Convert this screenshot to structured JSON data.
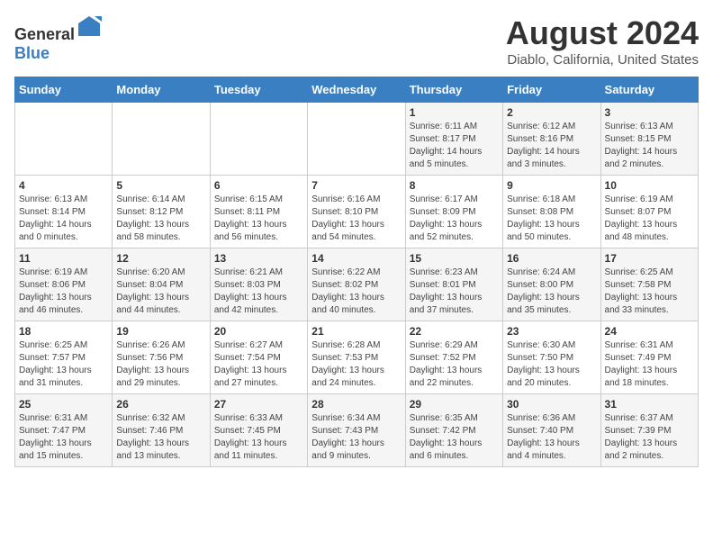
{
  "header": {
    "logo_general": "General",
    "logo_blue": "Blue",
    "title": "August 2024",
    "subtitle": "Diablo, California, United States"
  },
  "weekdays": [
    "Sunday",
    "Monday",
    "Tuesday",
    "Wednesday",
    "Thursday",
    "Friday",
    "Saturday"
  ],
  "weeks": [
    [
      {
        "day": "",
        "sunrise": "",
        "sunset": "",
        "daylight": ""
      },
      {
        "day": "",
        "sunrise": "",
        "sunset": "",
        "daylight": ""
      },
      {
        "day": "",
        "sunrise": "",
        "sunset": "",
        "daylight": ""
      },
      {
        "day": "",
        "sunrise": "",
        "sunset": "",
        "daylight": ""
      },
      {
        "day": "1",
        "sunrise": "Sunrise: 6:11 AM",
        "sunset": "Sunset: 8:17 PM",
        "daylight": "Daylight: 14 hours and 5 minutes."
      },
      {
        "day": "2",
        "sunrise": "Sunrise: 6:12 AM",
        "sunset": "Sunset: 8:16 PM",
        "daylight": "Daylight: 14 hours and 3 minutes."
      },
      {
        "day": "3",
        "sunrise": "Sunrise: 6:13 AM",
        "sunset": "Sunset: 8:15 PM",
        "daylight": "Daylight: 14 hours and 2 minutes."
      }
    ],
    [
      {
        "day": "4",
        "sunrise": "Sunrise: 6:13 AM",
        "sunset": "Sunset: 8:14 PM",
        "daylight": "Daylight: 14 hours and 0 minutes."
      },
      {
        "day": "5",
        "sunrise": "Sunrise: 6:14 AM",
        "sunset": "Sunset: 8:12 PM",
        "daylight": "Daylight: 13 hours and 58 minutes."
      },
      {
        "day": "6",
        "sunrise": "Sunrise: 6:15 AM",
        "sunset": "Sunset: 8:11 PM",
        "daylight": "Daylight: 13 hours and 56 minutes."
      },
      {
        "day": "7",
        "sunrise": "Sunrise: 6:16 AM",
        "sunset": "Sunset: 8:10 PM",
        "daylight": "Daylight: 13 hours and 54 minutes."
      },
      {
        "day": "8",
        "sunrise": "Sunrise: 6:17 AM",
        "sunset": "Sunset: 8:09 PM",
        "daylight": "Daylight: 13 hours and 52 minutes."
      },
      {
        "day": "9",
        "sunrise": "Sunrise: 6:18 AM",
        "sunset": "Sunset: 8:08 PM",
        "daylight": "Daylight: 13 hours and 50 minutes."
      },
      {
        "day": "10",
        "sunrise": "Sunrise: 6:19 AM",
        "sunset": "Sunset: 8:07 PM",
        "daylight": "Daylight: 13 hours and 48 minutes."
      }
    ],
    [
      {
        "day": "11",
        "sunrise": "Sunrise: 6:19 AM",
        "sunset": "Sunset: 8:06 PM",
        "daylight": "Daylight: 13 hours and 46 minutes."
      },
      {
        "day": "12",
        "sunrise": "Sunrise: 6:20 AM",
        "sunset": "Sunset: 8:04 PM",
        "daylight": "Daylight: 13 hours and 44 minutes."
      },
      {
        "day": "13",
        "sunrise": "Sunrise: 6:21 AM",
        "sunset": "Sunset: 8:03 PM",
        "daylight": "Daylight: 13 hours and 42 minutes."
      },
      {
        "day": "14",
        "sunrise": "Sunrise: 6:22 AM",
        "sunset": "Sunset: 8:02 PM",
        "daylight": "Daylight: 13 hours and 40 minutes."
      },
      {
        "day": "15",
        "sunrise": "Sunrise: 6:23 AM",
        "sunset": "Sunset: 8:01 PM",
        "daylight": "Daylight: 13 hours and 37 minutes."
      },
      {
        "day": "16",
        "sunrise": "Sunrise: 6:24 AM",
        "sunset": "Sunset: 8:00 PM",
        "daylight": "Daylight: 13 hours and 35 minutes."
      },
      {
        "day": "17",
        "sunrise": "Sunrise: 6:25 AM",
        "sunset": "Sunset: 7:58 PM",
        "daylight": "Daylight: 13 hours and 33 minutes."
      }
    ],
    [
      {
        "day": "18",
        "sunrise": "Sunrise: 6:25 AM",
        "sunset": "Sunset: 7:57 PM",
        "daylight": "Daylight: 13 hours and 31 minutes."
      },
      {
        "day": "19",
        "sunrise": "Sunrise: 6:26 AM",
        "sunset": "Sunset: 7:56 PM",
        "daylight": "Daylight: 13 hours and 29 minutes."
      },
      {
        "day": "20",
        "sunrise": "Sunrise: 6:27 AM",
        "sunset": "Sunset: 7:54 PM",
        "daylight": "Daylight: 13 hours and 27 minutes."
      },
      {
        "day": "21",
        "sunrise": "Sunrise: 6:28 AM",
        "sunset": "Sunset: 7:53 PM",
        "daylight": "Daylight: 13 hours and 24 minutes."
      },
      {
        "day": "22",
        "sunrise": "Sunrise: 6:29 AM",
        "sunset": "Sunset: 7:52 PM",
        "daylight": "Daylight: 13 hours and 22 minutes."
      },
      {
        "day": "23",
        "sunrise": "Sunrise: 6:30 AM",
        "sunset": "Sunset: 7:50 PM",
        "daylight": "Daylight: 13 hours and 20 minutes."
      },
      {
        "day": "24",
        "sunrise": "Sunrise: 6:31 AM",
        "sunset": "Sunset: 7:49 PM",
        "daylight": "Daylight: 13 hours and 18 minutes."
      }
    ],
    [
      {
        "day": "25",
        "sunrise": "Sunrise: 6:31 AM",
        "sunset": "Sunset: 7:47 PM",
        "daylight": "Daylight: 13 hours and 15 minutes."
      },
      {
        "day": "26",
        "sunrise": "Sunrise: 6:32 AM",
        "sunset": "Sunset: 7:46 PM",
        "daylight": "Daylight: 13 hours and 13 minutes."
      },
      {
        "day": "27",
        "sunrise": "Sunrise: 6:33 AM",
        "sunset": "Sunset: 7:45 PM",
        "daylight": "Daylight: 13 hours and 11 minutes."
      },
      {
        "day": "28",
        "sunrise": "Sunrise: 6:34 AM",
        "sunset": "Sunset: 7:43 PM",
        "daylight": "Daylight: 13 hours and 9 minutes."
      },
      {
        "day": "29",
        "sunrise": "Sunrise: 6:35 AM",
        "sunset": "Sunset: 7:42 PM",
        "daylight": "Daylight: 13 hours and 6 minutes."
      },
      {
        "day": "30",
        "sunrise": "Sunrise: 6:36 AM",
        "sunset": "Sunset: 7:40 PM",
        "daylight": "Daylight: 13 hours and 4 minutes."
      },
      {
        "day": "31",
        "sunrise": "Sunrise: 6:37 AM",
        "sunset": "Sunset: 7:39 PM",
        "daylight": "Daylight: 13 hours and 2 minutes."
      }
    ]
  ]
}
